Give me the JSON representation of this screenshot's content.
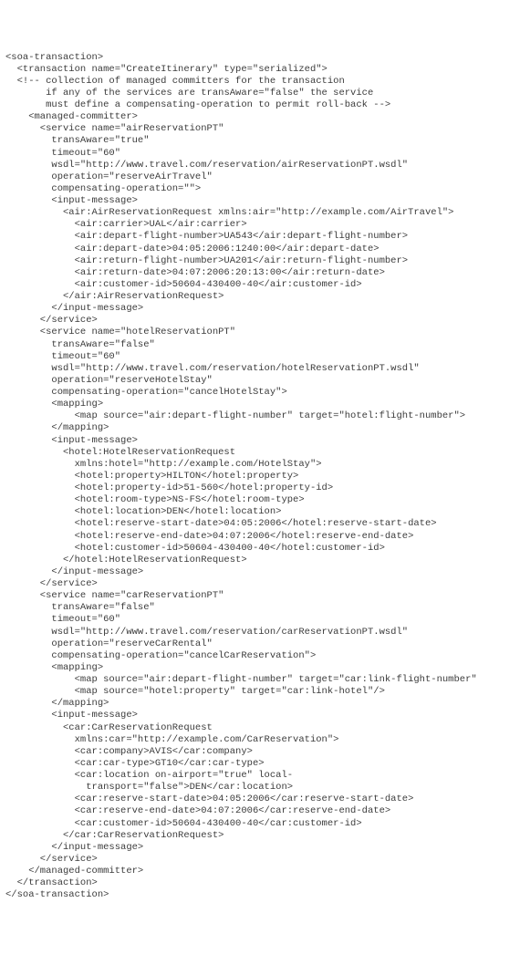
{
  "lines": [
    {
      "i": 0,
      "t": "<soa-transaction>"
    },
    {
      "i": 1,
      "t": "<transaction name=\"CreateItinerary\" type=\"serialized\">"
    },
    {
      "i": 1,
      "t": "<!-- collection of managed committers for the transaction"
    },
    {
      "i": 2,
      "t": "   if any of the services are transAware=\"false\" the service"
    },
    {
      "i": 2,
      "t": "   must define a compensating-operation to permit roll-back -->"
    },
    {
      "i": 2,
      "t": "<managed-committer>"
    },
    {
      "i": 3,
      "t": "<service name=\"airReservationPT\""
    },
    {
      "i": 4,
      "t": "transAware=\"true\""
    },
    {
      "i": 4,
      "t": "timeout=\"60\""
    },
    {
      "i": 4,
      "t": "wsdl=\"http://www.travel.com/reservation/airReservationPT.wsdl\""
    },
    {
      "i": 4,
      "t": "operation=\"reserveAirTravel\""
    },
    {
      "i": 4,
      "t": "compensating-operation=\"\">"
    },
    {
      "i": 4,
      "t": "<input-message>"
    },
    {
      "i": 5,
      "t": "<air:AirReservationRequest xmlns:air=\"http://example.com/AirTravel\">"
    },
    {
      "i": 6,
      "t": "<air:carrier>UAL</air:carrier>"
    },
    {
      "i": 6,
      "t": "<air:depart-flight-number>UA543</air:depart-flight-number>"
    },
    {
      "i": 6,
      "t": "<air:depart-date>04:05:2006:1240:00</air:depart-date>"
    },
    {
      "i": 6,
      "t": "<air:return-flight-number>UA201</air:return-flight-number>"
    },
    {
      "i": 6,
      "t": "<air:return-date>04:07:2006:20:13:00</air:return-date>"
    },
    {
      "i": 6,
      "t": "<air:customer-id>50604-430400-40</air:customer-id>"
    },
    {
      "i": 5,
      "t": "</air:AirReservationRequest>"
    },
    {
      "i": 4,
      "t": "</input-message>"
    },
    {
      "i": 3,
      "t": "</service>"
    },
    {
      "i": 3,
      "t": "<service name=\"hotelReservationPT\""
    },
    {
      "i": 4,
      "t": "transAware=\"false\""
    },
    {
      "i": 4,
      "t": "timeout=\"60\""
    },
    {
      "i": 4,
      "t": "wsdl=\"http://www.travel.com/reservation/hotelReservationPT.wsdl\""
    },
    {
      "i": 4,
      "t": "operation=\"reserveHotelStay\""
    },
    {
      "i": 4,
      "t": "compensating-operation=\"cancelHotelStay\">"
    },
    {
      "i": 4,
      "t": "<mapping>"
    },
    {
      "i": 6,
      "t": "<map source=\"air:depart-flight-number\" target=\"hotel:flight-number\">"
    },
    {
      "i": 4,
      "t": "</mapping>"
    },
    {
      "i": 4,
      "t": "<input-message>"
    },
    {
      "i": 5,
      "t": "<hotel:HotelReservationRequest"
    },
    {
      "i": 6,
      "t": "xmlns:hotel=\"http://example.com/HotelStay\">"
    },
    {
      "i": 6,
      "t": "<hotel:property>HILTON</hotel:property>"
    },
    {
      "i": 6,
      "t": "<hotel:property-id>51-560</hotel:property-id>"
    },
    {
      "i": 6,
      "t": "<hotel:room-type>NS-FS</hotel:room-type>"
    },
    {
      "i": 6,
      "t": "<hotel:location>DEN</hotel:location>"
    },
    {
      "i": 6,
      "t": "<hotel:reserve-start-date>04:05:2006</hotel:reserve-start-date>"
    },
    {
      "i": 6,
      "t": "<hotel:reserve-end-date>04:07:2006</hotel:reserve-end-date>"
    },
    {
      "i": 6,
      "t": "<hotel:customer-id>50604-430400-40</hotel:customer-id>"
    },
    {
      "i": 5,
      "t": "</hotel:HotelReservationRequest>"
    },
    {
      "i": 4,
      "t": "</input-message>"
    },
    {
      "i": 3,
      "t": "</service>"
    },
    {
      "i": 3,
      "t": "<service name=\"carReservationPT\""
    },
    {
      "i": 4,
      "t": "transAware=\"false\""
    },
    {
      "i": 4,
      "t": "timeout=\"60\""
    },
    {
      "i": 4,
      "t": "wsdl=\"http://www.travel.com/reservation/carReservationPT.wsdl\""
    },
    {
      "i": 4,
      "t": "operation=\"reserveCarRental\""
    },
    {
      "i": 4,
      "t": "compensating-operation=\"cancelCarReservation\">"
    },
    {
      "i": 4,
      "t": "<mapping>"
    },
    {
      "i": 6,
      "t": "<map source=\"air:depart-flight-number\" target=\"car:link-flight-number\""
    },
    {
      "i": 6,
      "t": "<map source=\"hotel:property\" target=\"car:link-hotel\"/>"
    },
    {
      "i": 4,
      "t": "</mapping>"
    },
    {
      "i": 4,
      "t": "<input-message>"
    },
    {
      "i": 5,
      "t": "<car:CarReservationRequest"
    },
    {
      "i": 6,
      "t": "xmlns:car=\"http://example.com/CarReservation\">"
    },
    {
      "i": 6,
      "t": "<car:company>AVIS</car:company>"
    },
    {
      "i": 6,
      "t": "<car:car-type>GT10</car:car-type>"
    },
    {
      "i": 6,
      "t": "<car:location on-airport=\"true\" local-"
    },
    {
      "i": 6,
      "t": "  transport=\"false\">DEN</car:location>"
    },
    {
      "i": 6,
      "t": "<car:reserve-start-date>04:05:2006</car:reserve-start-date>"
    },
    {
      "i": 6,
      "t": "<car:reserve-end-date>04:07:2006</car:reserve-end-date>"
    },
    {
      "i": 6,
      "t": "<car:customer-id>50604-430400-40</car:customer-id>"
    },
    {
      "i": 5,
      "t": "</car:CarReservationRequest>"
    },
    {
      "i": 4,
      "t": "</input-message>"
    },
    {
      "i": 3,
      "t": "</service>"
    },
    {
      "i": 2,
      "t": "</managed-committer>"
    },
    {
      "i": 1,
      "t": "</transaction>"
    },
    {
      "i": 0,
      "t": "</soa-transaction>"
    }
  ]
}
